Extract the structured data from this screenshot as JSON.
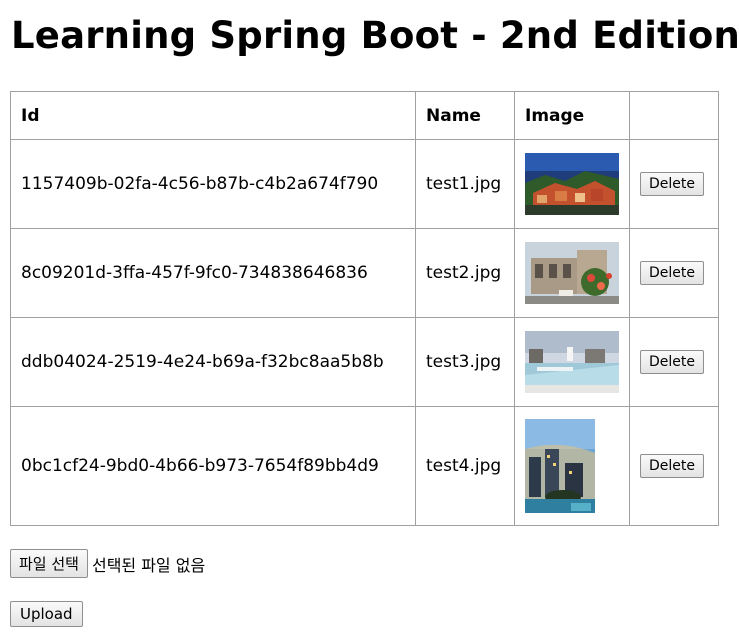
{
  "page": {
    "title": "Learning Spring Boot - 2nd Edition"
  },
  "table": {
    "headers": {
      "id": "Id",
      "name": "Name",
      "image": "Image",
      "action": ""
    },
    "rows": [
      {
        "id": "1157409b-02fa-4c56-b87b-c4b2a674f790",
        "name": "test1.jpg",
        "delete_label": "Delete",
        "thumb": "old-town-river-photo"
      },
      {
        "id": "8c09201d-3ffa-457f-9fc0-734838646836",
        "name": "test2.jpg",
        "delete_label": "Delete",
        "thumb": "theater-with-flowers-photo"
      },
      {
        "id": "ddb04024-2519-4e24-b69a-f32bc8aa5b8b",
        "name": "test3.jpg",
        "delete_label": "Delete",
        "thumb": "rooftop-pool-photo"
      },
      {
        "id": "0bc1cf24-9bd0-4b66-b973-7654f89bb4d9",
        "name": "test4.jpg",
        "delete_label": "Delete",
        "thumb": "city-rooftop-dusk-photo"
      }
    ]
  },
  "upload": {
    "choose_file_label": "파일 선택",
    "no_file_text": "선택된 파일 없음",
    "upload_label": "Upload"
  }
}
